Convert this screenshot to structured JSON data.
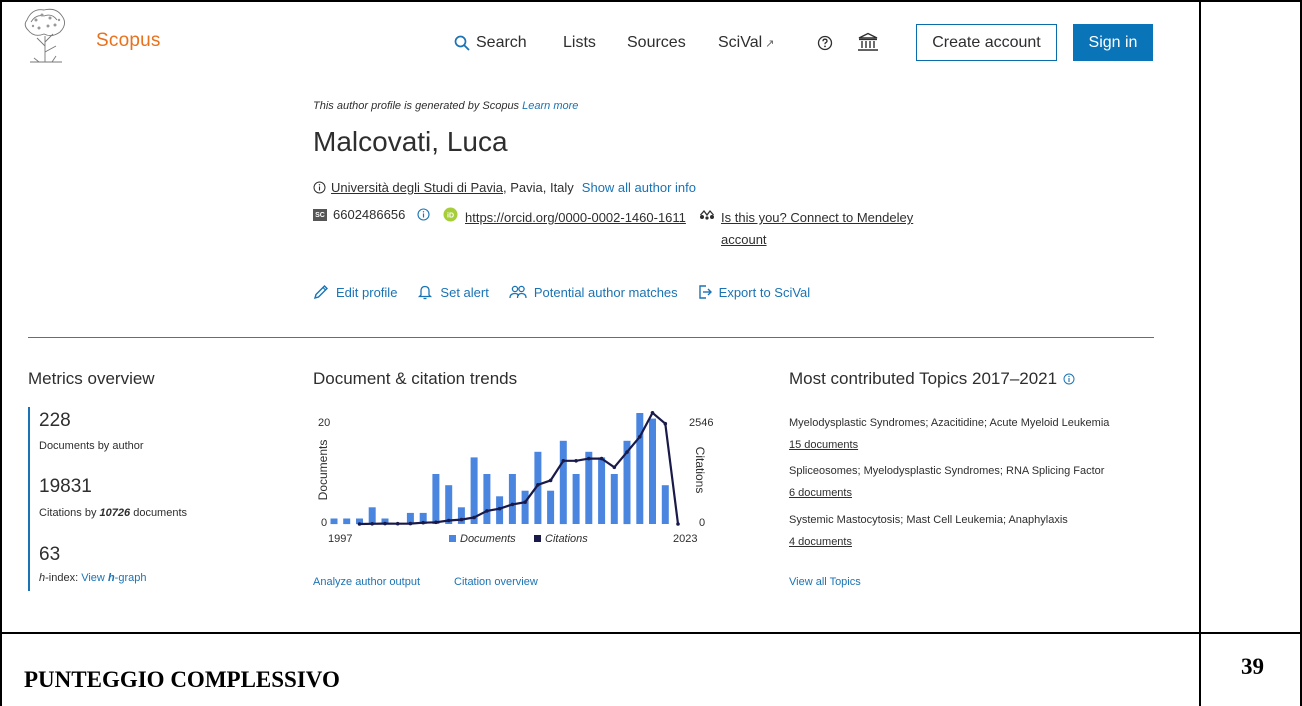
{
  "brand": {
    "name": "Scopus"
  },
  "nav": {
    "search": "Search",
    "lists": "Lists",
    "sources": "Sources",
    "scival": "SciVal",
    "scival_ext": "↗",
    "create_account": "Create account",
    "sign_in": "Sign in"
  },
  "profile": {
    "generated_prefix": "This author profile is generated by Scopus",
    "learn_more": "Learn more",
    "name": "Malcovati, Luca",
    "affiliation": "Università degli Studi di Pavia",
    "location": ", Pavia, Italy",
    "show_all": "Show all author info",
    "scopus_id": "6602486656",
    "sc_badge": "SC",
    "orcid": "https://orcid.org/0000-0002-1460-1611",
    "mendeley": "Is this you? Connect to Mendeley account"
  },
  "actions": {
    "edit_profile": "Edit profile",
    "set_alert": "Set alert",
    "potential_matches": "Potential author matches",
    "export": "Export to SciVal"
  },
  "metrics": {
    "title": "Metrics overview",
    "documents": "228",
    "documents_label": "Documents by author",
    "citations": "19831",
    "citations_label_prefix": "Citations by",
    "citations_docs": "10726",
    "citations_label_suffix": "documents",
    "hindex": "63",
    "hindex_label_h": "h",
    "hindex_label_rest": "-index:",
    "hgraph_view": "View",
    "hgraph_h": "h",
    "hgraph_rest": "-graph"
  },
  "trends": {
    "title": "Document & citation trends",
    "analyze": "Analyze author output",
    "citation_overview": "Citation overview"
  },
  "chart_data": {
    "type": "bar",
    "x_start_label": "1997",
    "x_end_label": "2023",
    "ylabel_left": "Documents",
    "ylabel_right": "Citations",
    "left_max_label": "20",
    "left_min_label": "0",
    "right_max_label": "2546",
    "right_min_label": "0",
    "ylim_left": [
      0,
      20
    ],
    "ylim_right": [
      0,
      2546
    ],
    "legend": [
      "Documents",
      "Citations"
    ],
    "colors": {
      "documents": "#4a86e0",
      "citations": "#1a1a4a"
    },
    "series": [
      {
        "name": "Documents",
        "values": [
          1,
          1,
          1,
          3,
          1,
          0,
          2,
          2,
          9,
          7,
          3,
          12,
          9,
          5,
          9,
          6,
          13,
          6,
          15,
          9,
          13,
          12,
          9,
          15,
          20,
          19,
          7,
          0
        ]
      },
      {
        "name": "Citations",
        "values": [
          0,
          0,
          0,
          5,
          10,
          8,
          10,
          30,
          40,
          80,
          100,
          150,
          300,
          350,
          450,
          500,
          900,
          1000,
          1450,
          1450,
          1500,
          1500,
          1300,
          1650,
          2000,
          2550,
          2300,
          0
        ]
      }
    ]
  },
  "topics": {
    "title": "Most contributed Topics 2017–2021",
    "items": [
      {
        "name": "Myelodysplastic Syndromes; Azacitidine; Acute Myeloid Leukemia",
        "docs": "15 documents"
      },
      {
        "name": "Spliceosomes; Myelodysplastic Syndromes; RNA Splicing Factor",
        "docs": "6 documents"
      },
      {
        "name": "Systemic Mastocytosis; Mast Cell Leukemia; Anaphylaxis",
        "docs": "4 documents"
      }
    ],
    "view_all": "View all Topics"
  },
  "score": {
    "label": "PUNTEGGIO COMPLESSIVO",
    "value": "39"
  }
}
